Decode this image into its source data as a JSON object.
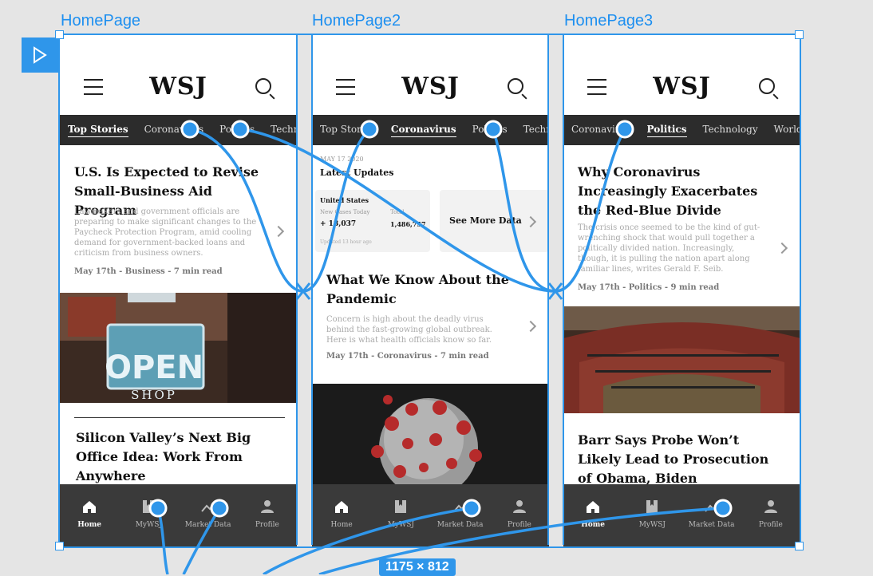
{
  "frames": [
    {
      "label": "HomePage",
      "logo": "WSJ",
      "tabs": [
        "Top Stories",
        "Coronavirus",
        "Politics",
        "Technology"
      ],
      "active_tab": 0,
      "story1": {
        "title": "U.S. Is Expected to Revise Small-Business Aid Program",
        "desc": "Lawmakers and government officials are preparing to make significant changes to the Paycheck Protection Program, amid cooling demand for government-backed loans and criticism from business owners.",
        "meta": "May 17th - Business - 7 min read"
      },
      "image_text": {
        "open": "OPEN",
        "shop": "SHOP"
      },
      "story2": {
        "title": "Silicon Valley’s Next Big Office Idea: Work From Anywhere"
      }
    },
    {
      "label": "HomePage2",
      "logo": "WSJ",
      "tabs": [
        "Top Stories",
        "Coronavirus",
        "Politics",
        "Technology"
      ],
      "active_tab": 1,
      "date": "MAY 17 2020",
      "updates_title": "Latest Updates",
      "stats": {
        "region": "United States",
        "new_label": "New Cases Today",
        "total_label": "Total",
        "new_value": "+ 18,037",
        "total_value": "1,486,757",
        "updated": "Updated 13 hour ago"
      },
      "see_more": "See More Data",
      "story1": {
        "title": "What We Know About the Pandemic",
        "desc": "Concern is high about the deadly virus behind the fast-growing global outbreak. Here is what health officials know so far.",
        "meta": "May 17th - Coronavirus - 7 min read"
      }
    },
    {
      "label": "HomePage3",
      "logo": "WSJ",
      "tabs": [
        "Coronavirus",
        "Politics",
        "Technology",
        "World News"
      ],
      "active_tab": 1,
      "story1": {
        "title": "Why Coronavirus Increasingly Exacerbates the Red-Blue Divide",
        "desc": "The crisis once seemed to be the kind of gut-wrenching shock that would pull together a politically divided nation. Increasingly, though, it is pulling the nation apart along familiar lines, writes Gerald F. Seib.",
        "meta": "May 17th - Politics - 9 min read"
      },
      "story2": {
        "title": "Barr Says Probe Won’t Likely Lead to Prosecution of Obama, Biden"
      }
    }
  ],
  "bottom_nav": [
    "Home",
    "MyWSJ",
    "Market Data",
    "Profile"
  ],
  "icons": {
    "play": "play-icon",
    "menu": "menu-icon",
    "search": "search-icon",
    "home": "home-icon",
    "bookmark": "bookmark-icon",
    "chart": "chart-icon",
    "profile": "profile-icon"
  },
  "selection_size": "1175 × 812",
  "colors": {
    "accent": "#2f96ea",
    "nav_bg": "#2c2c2c",
    "canvas_bg": "#e5e5e5"
  }
}
